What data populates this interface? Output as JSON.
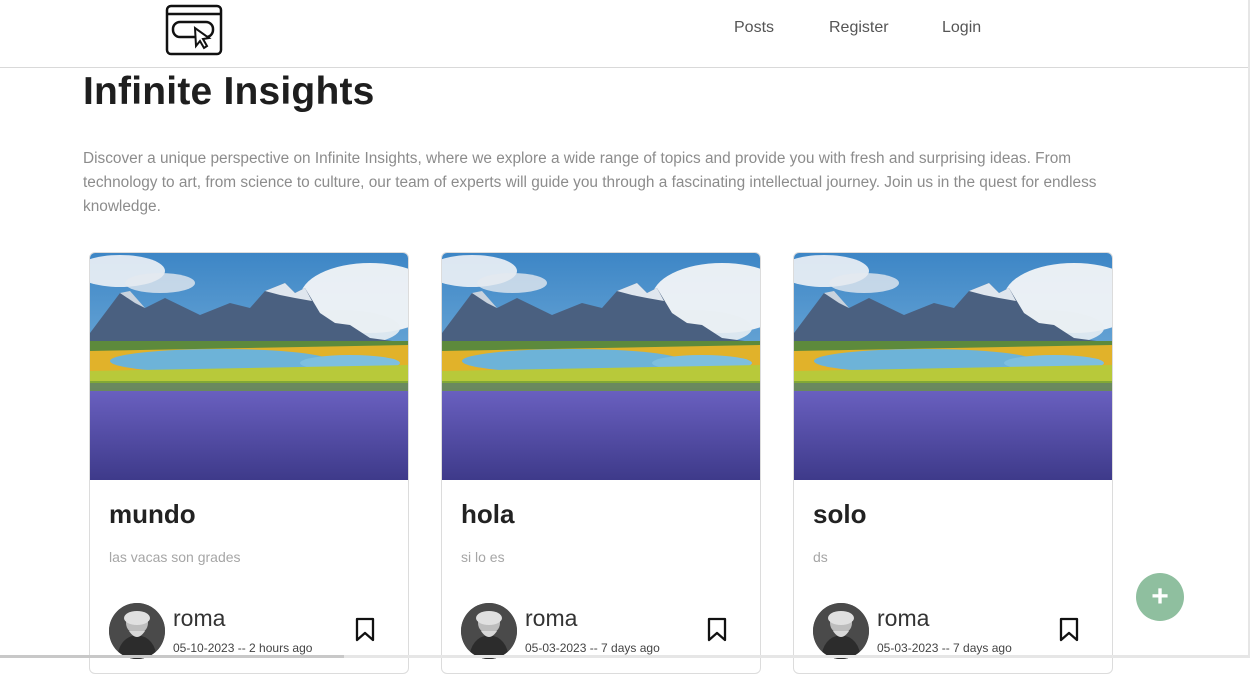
{
  "nav": {
    "links": [
      {
        "label": "Posts"
      },
      {
        "label": "Register"
      },
      {
        "label": "Login"
      }
    ]
  },
  "hero": {
    "title": "Infinite Insights",
    "description": "Discover a unique perspective on Infinite Insights, where we explore a wide range of topics and provide you with fresh and surprising ideas. From technology to art, from science to culture, our team of experts will guide you through a fascinating intellectual journey. Join us in the quest for endless knowledge."
  },
  "posts": [
    {
      "title": "mundo",
      "description": "las vacas son grades",
      "author": "roma",
      "date": "05-10-2023 -- 2 hours ago"
    },
    {
      "title": "hola",
      "description": "si lo es",
      "author": "roma",
      "date": "05-03-2023 -- 7 days ago"
    },
    {
      "title": "solo",
      "description": "ds",
      "author": "roma",
      "date": "05-03-2023 -- 7 days ago"
    }
  ],
  "fab": {
    "icon": "plus-icon",
    "label": "+"
  },
  "colors": {
    "fab": "#8fbf9f",
    "muted_text": "#8c8c8c"
  }
}
